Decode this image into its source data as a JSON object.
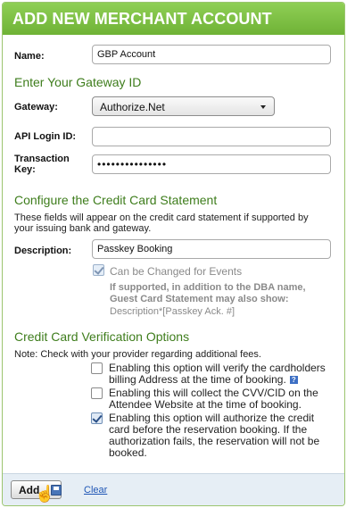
{
  "header": {
    "title": "ADD NEW MERCHANT ACCOUNT"
  },
  "name": {
    "label": "Name:",
    "value": "GBP Account"
  },
  "gateway_section": {
    "title": "Enter Your Gateway ID",
    "gateway_label": "Gateway:",
    "gateway_value": "Authorize.Net",
    "api_login_label": "API Login ID:",
    "api_login_value": "",
    "transaction_key_label_line1": "Transaction",
    "transaction_key_label_line2": "Key:",
    "transaction_key_value": "•••••••••••••••"
  },
  "statement_section": {
    "title": "Configure the Credit Card Statement",
    "note": "These fields will appear on the credit card statement if supported by your issuing bank and gateway.",
    "description_label": "Description:",
    "description_value": "Passkey Booking",
    "can_change_label": "Can be Changed for Events",
    "can_change_checked": true,
    "dba_note_line1": "If supported, in addition to the DBA name,",
    "dba_note_line2": "Guest Card Statement may also show:",
    "dba_note_line3": "Description*[Passkey Ack. #]"
  },
  "verification_section": {
    "title": "Credit Card Verification Options",
    "note": "Note: Check with your provider regarding additional fees.",
    "options": [
      {
        "label": "Enabling this option will verify the cardholders billing Address at the time of booking.",
        "checked": false
      },
      {
        "label": "Enabling this will collect the CVV/CID on the Attendee Website at the time of booking.",
        "checked": false
      },
      {
        "label": "Enabling this option will authorize the credit card before the reservation booking. If the authorization fails, the reservation will not be booked.",
        "checked": true
      }
    ],
    "help_icon": "?"
  },
  "footer": {
    "add_label": "Add",
    "clear_label": "Clear"
  }
}
